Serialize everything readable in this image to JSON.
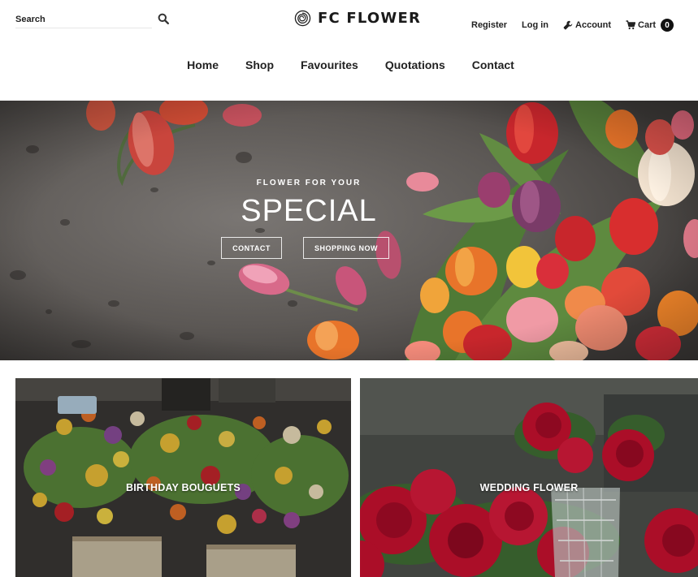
{
  "header": {
    "search": {
      "placeholder": "Search"
    },
    "logo": {
      "text": "FC FLOWER"
    },
    "util": {
      "register": "Register",
      "login": "Log in",
      "account": "Account",
      "cart": "Cart",
      "cart_count": "0"
    },
    "nav": [
      "Home",
      "Shop",
      "Favourites",
      "Quotations",
      "Contact"
    ]
  },
  "hero": {
    "kicker": "FLOWER FOR YOUR",
    "title": "SPECIAL",
    "buttons": {
      "contact": "CONTACT",
      "shop": "SHOPPING NOW"
    }
  },
  "categories": [
    {
      "label": "BIRTHDAY BOUGUETS"
    },
    {
      "label": "WEDDING FLOWER"
    }
  ],
  "icons": {
    "search": "magnifier-icon",
    "logo": "rose-icon",
    "account": "wrench-icon",
    "cart": "cart-icon"
  },
  "colors": {
    "text": "#222222",
    "tulip_red": "#c8262c",
    "tulip_orange": "#e8742a",
    "tulip_pink": "#e58a9b",
    "tulip_yellow": "#f2c43a",
    "rose_red": "#c3102e"
  }
}
